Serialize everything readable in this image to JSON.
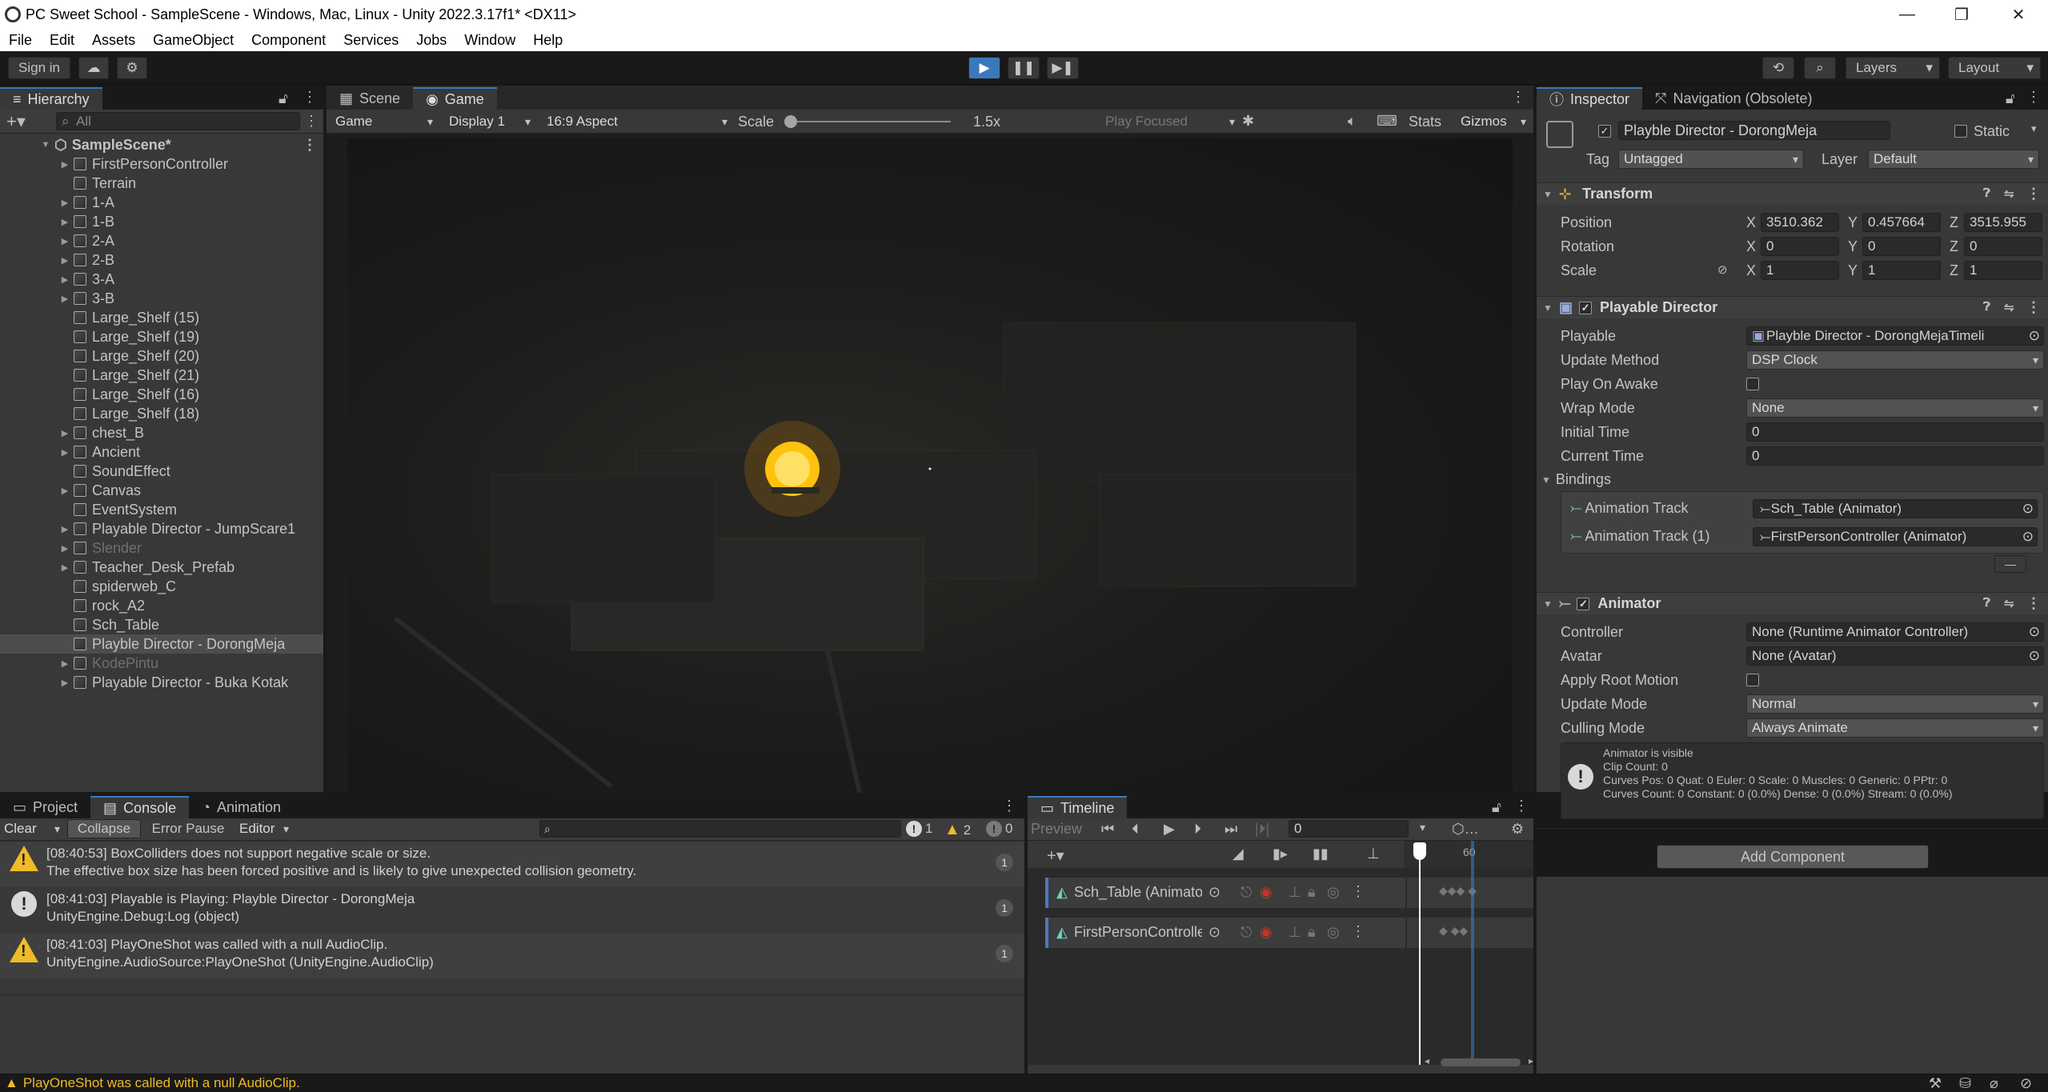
{
  "window": {
    "title": "PC Sweet School - SampleScene - Windows, Mac, Linux - Unity 2022.3.17f1* <DX11>"
  },
  "menu": [
    "File",
    "Edit",
    "Assets",
    "GameObject",
    "Component",
    "Services",
    "Jobs",
    "Window",
    "Help"
  ],
  "toolbar": {
    "sign_in": "Sign in",
    "layers": "Layers",
    "layout": "Layout"
  },
  "hierarchy": {
    "tab": "Hierarchy",
    "search_placeholder": "All",
    "scene": "SampleScene*",
    "items": [
      {
        "label": "FirstPersonController",
        "arrow": true,
        "dim": false,
        "sel": false
      },
      {
        "label": "Terrain",
        "arrow": false,
        "dim": false,
        "sel": false
      },
      {
        "label": "1-A",
        "arrow": true,
        "dim": false,
        "sel": false
      },
      {
        "label": "1-B",
        "arrow": true,
        "dim": false,
        "sel": false
      },
      {
        "label": "2-A",
        "arrow": true,
        "dim": false,
        "sel": false
      },
      {
        "label": "2-B",
        "arrow": true,
        "dim": false,
        "sel": false
      },
      {
        "label": "3-A",
        "arrow": true,
        "dim": false,
        "sel": false
      },
      {
        "label": "3-B",
        "arrow": true,
        "dim": false,
        "sel": false
      },
      {
        "label": "Large_Shelf (15)",
        "arrow": false,
        "dim": false,
        "sel": false
      },
      {
        "label": "Large_Shelf (19)",
        "arrow": false,
        "dim": false,
        "sel": false
      },
      {
        "label": "Large_Shelf (20)",
        "arrow": false,
        "dim": false,
        "sel": false
      },
      {
        "label": "Large_Shelf (21)",
        "arrow": false,
        "dim": false,
        "sel": false
      },
      {
        "label": "Large_Shelf (16)",
        "arrow": false,
        "dim": false,
        "sel": false
      },
      {
        "label": "Large_Shelf (18)",
        "arrow": false,
        "dim": false,
        "sel": false
      },
      {
        "label": "chest_B",
        "arrow": true,
        "dim": false,
        "sel": false
      },
      {
        "label": "Ancient",
        "arrow": true,
        "dim": false,
        "sel": false
      },
      {
        "label": "SoundEffect",
        "arrow": false,
        "dim": false,
        "sel": false
      },
      {
        "label": "Canvas",
        "arrow": true,
        "dim": false,
        "sel": false
      },
      {
        "label": "EventSystem",
        "arrow": false,
        "dim": false,
        "sel": false
      },
      {
        "label": "Playable Director - JumpScare1",
        "arrow": true,
        "dim": false,
        "sel": false
      },
      {
        "label": "Slender",
        "arrow": true,
        "dim": true,
        "sel": false
      },
      {
        "label": "Teacher_Desk_Prefab",
        "arrow": true,
        "dim": false,
        "sel": false
      },
      {
        "label": "spiderweb_C",
        "arrow": false,
        "dim": false,
        "sel": false
      },
      {
        "label": "rock_A2",
        "arrow": false,
        "dim": false,
        "sel": false
      },
      {
        "label": "Sch_Table",
        "arrow": false,
        "dim": false,
        "sel": false
      },
      {
        "label": "Playble Director - DorongMeja",
        "arrow": false,
        "dim": false,
        "sel": true
      },
      {
        "label": "KodePintu",
        "arrow": true,
        "dim": true,
        "sel": false
      },
      {
        "label": "Playable Director - Buka Kotak",
        "arrow": true,
        "dim": false,
        "sel": false
      }
    ]
  },
  "game": {
    "tabs": [
      "Scene",
      "Game"
    ],
    "mode": "Game",
    "display": "Display 1",
    "aspect": "16:9 Aspect",
    "scale_label": "Scale",
    "scale_value": "1.5x",
    "play_focused": "Play Focused",
    "stats": "Stats",
    "gizmos": "Gizmos"
  },
  "inspector": {
    "tabs": [
      "Inspector",
      "Navigation (Obsolete)"
    ],
    "object_name": "Playble Director - DorongMeja",
    "static": "Static",
    "tag_label": "Tag",
    "tag_value": "Untagged",
    "layer_label": "Layer",
    "layer_value": "Default",
    "transform": {
      "title": "Transform",
      "position": {
        "label": "Position",
        "x": "3510.362",
        "y": "0.457664",
        "z": "3515.955"
      },
      "rotation": {
        "label": "Rotation",
        "x": "0",
        "y": "0",
        "z": "0"
      },
      "scale": {
        "label": "Scale",
        "x": "1",
        "y": "1",
        "z": "1"
      }
    },
    "playable_director": {
      "title": "Playable Director",
      "playable_label": "Playable",
      "playable_value": "Playble Director - DorongMejaTimeli",
      "update_method_label": "Update Method",
      "update_method_value": "DSP Clock",
      "play_on_awake_label": "Play On Awake",
      "wrap_mode_label": "Wrap Mode",
      "wrap_mode_value": "None",
      "initial_time_label": "Initial Time",
      "initial_time_value": "0",
      "current_time_label": "Current Time",
      "current_time_value": "0",
      "bindings_label": "Bindings",
      "bindings": [
        {
          "track": "Animation Track",
          "value": "Sch_Table (Animator)"
        },
        {
          "track": "Animation Track (1)",
          "value": "FirstPersonController (Animator)"
        }
      ],
      "minus": "—"
    },
    "animator": {
      "title": "Animator",
      "controller_label": "Controller",
      "controller_value": "None (Runtime Animator Controller)",
      "avatar_label": "Avatar",
      "avatar_value": "None (Avatar)",
      "apply_root_motion_label": "Apply Root Motion",
      "update_mode_label": "Update Mode",
      "update_mode_value": "Normal",
      "culling_mode_label": "Culling Mode",
      "culling_mode_value": "Always Animate",
      "info_lines": [
        "Animator is visible",
        "Clip Count: 0",
        "Curves Pos: 0 Quat: 0 Euler: 0 Scale: 0 Muscles: 0 Generic: 0 PPtr: 0",
        "Curves Count: 0 Constant: 0 (0.0%) Dense: 0 (0.0%) Stream: 0 (0.0%)"
      ]
    },
    "add_component": "Add Component"
  },
  "console": {
    "tabs": [
      "Project",
      "Console",
      "Animation"
    ],
    "clear": "Clear",
    "collapse": "Collapse",
    "error_pause": "Error Pause",
    "editor": "Editor",
    "count_info": "1",
    "count_warn": "2",
    "count_error": "0",
    "entries": [
      {
        "type": "warn",
        "line1": "[08:40:53] BoxColliders does not support negative scale or size.",
        "line2": "The effective box size has been forced positive and is likely to give unexpected collision geometry.",
        "count": "1"
      },
      {
        "type": "info",
        "line1": "[08:41:03] Playable is Playing: Playble Director - DorongMeja",
        "line2": "UnityEngine.Debug:Log (object)",
        "count": "1"
      },
      {
        "type": "warn",
        "line1": "[08:41:03] PlayOneShot was called with a null AudioClip.",
        "line2": "UnityEngine.AudioSource:PlayOneShot (UnityEngine.AudioClip)",
        "count": "1"
      }
    ]
  },
  "timeline": {
    "tab": "Timeline",
    "preview": "Preview",
    "frame": "0",
    "ruler_mark": "60",
    "tracks": [
      {
        "label": "Sch_Table (Animato"
      },
      {
        "label": "FirstPersonControlle"
      }
    ]
  },
  "status": {
    "message": "PlayOneShot was called with a null AudioClip."
  },
  "colors": {
    "accent": "#3a79bb",
    "warning": "#f0bb26",
    "playhead": "#ffffff"
  }
}
